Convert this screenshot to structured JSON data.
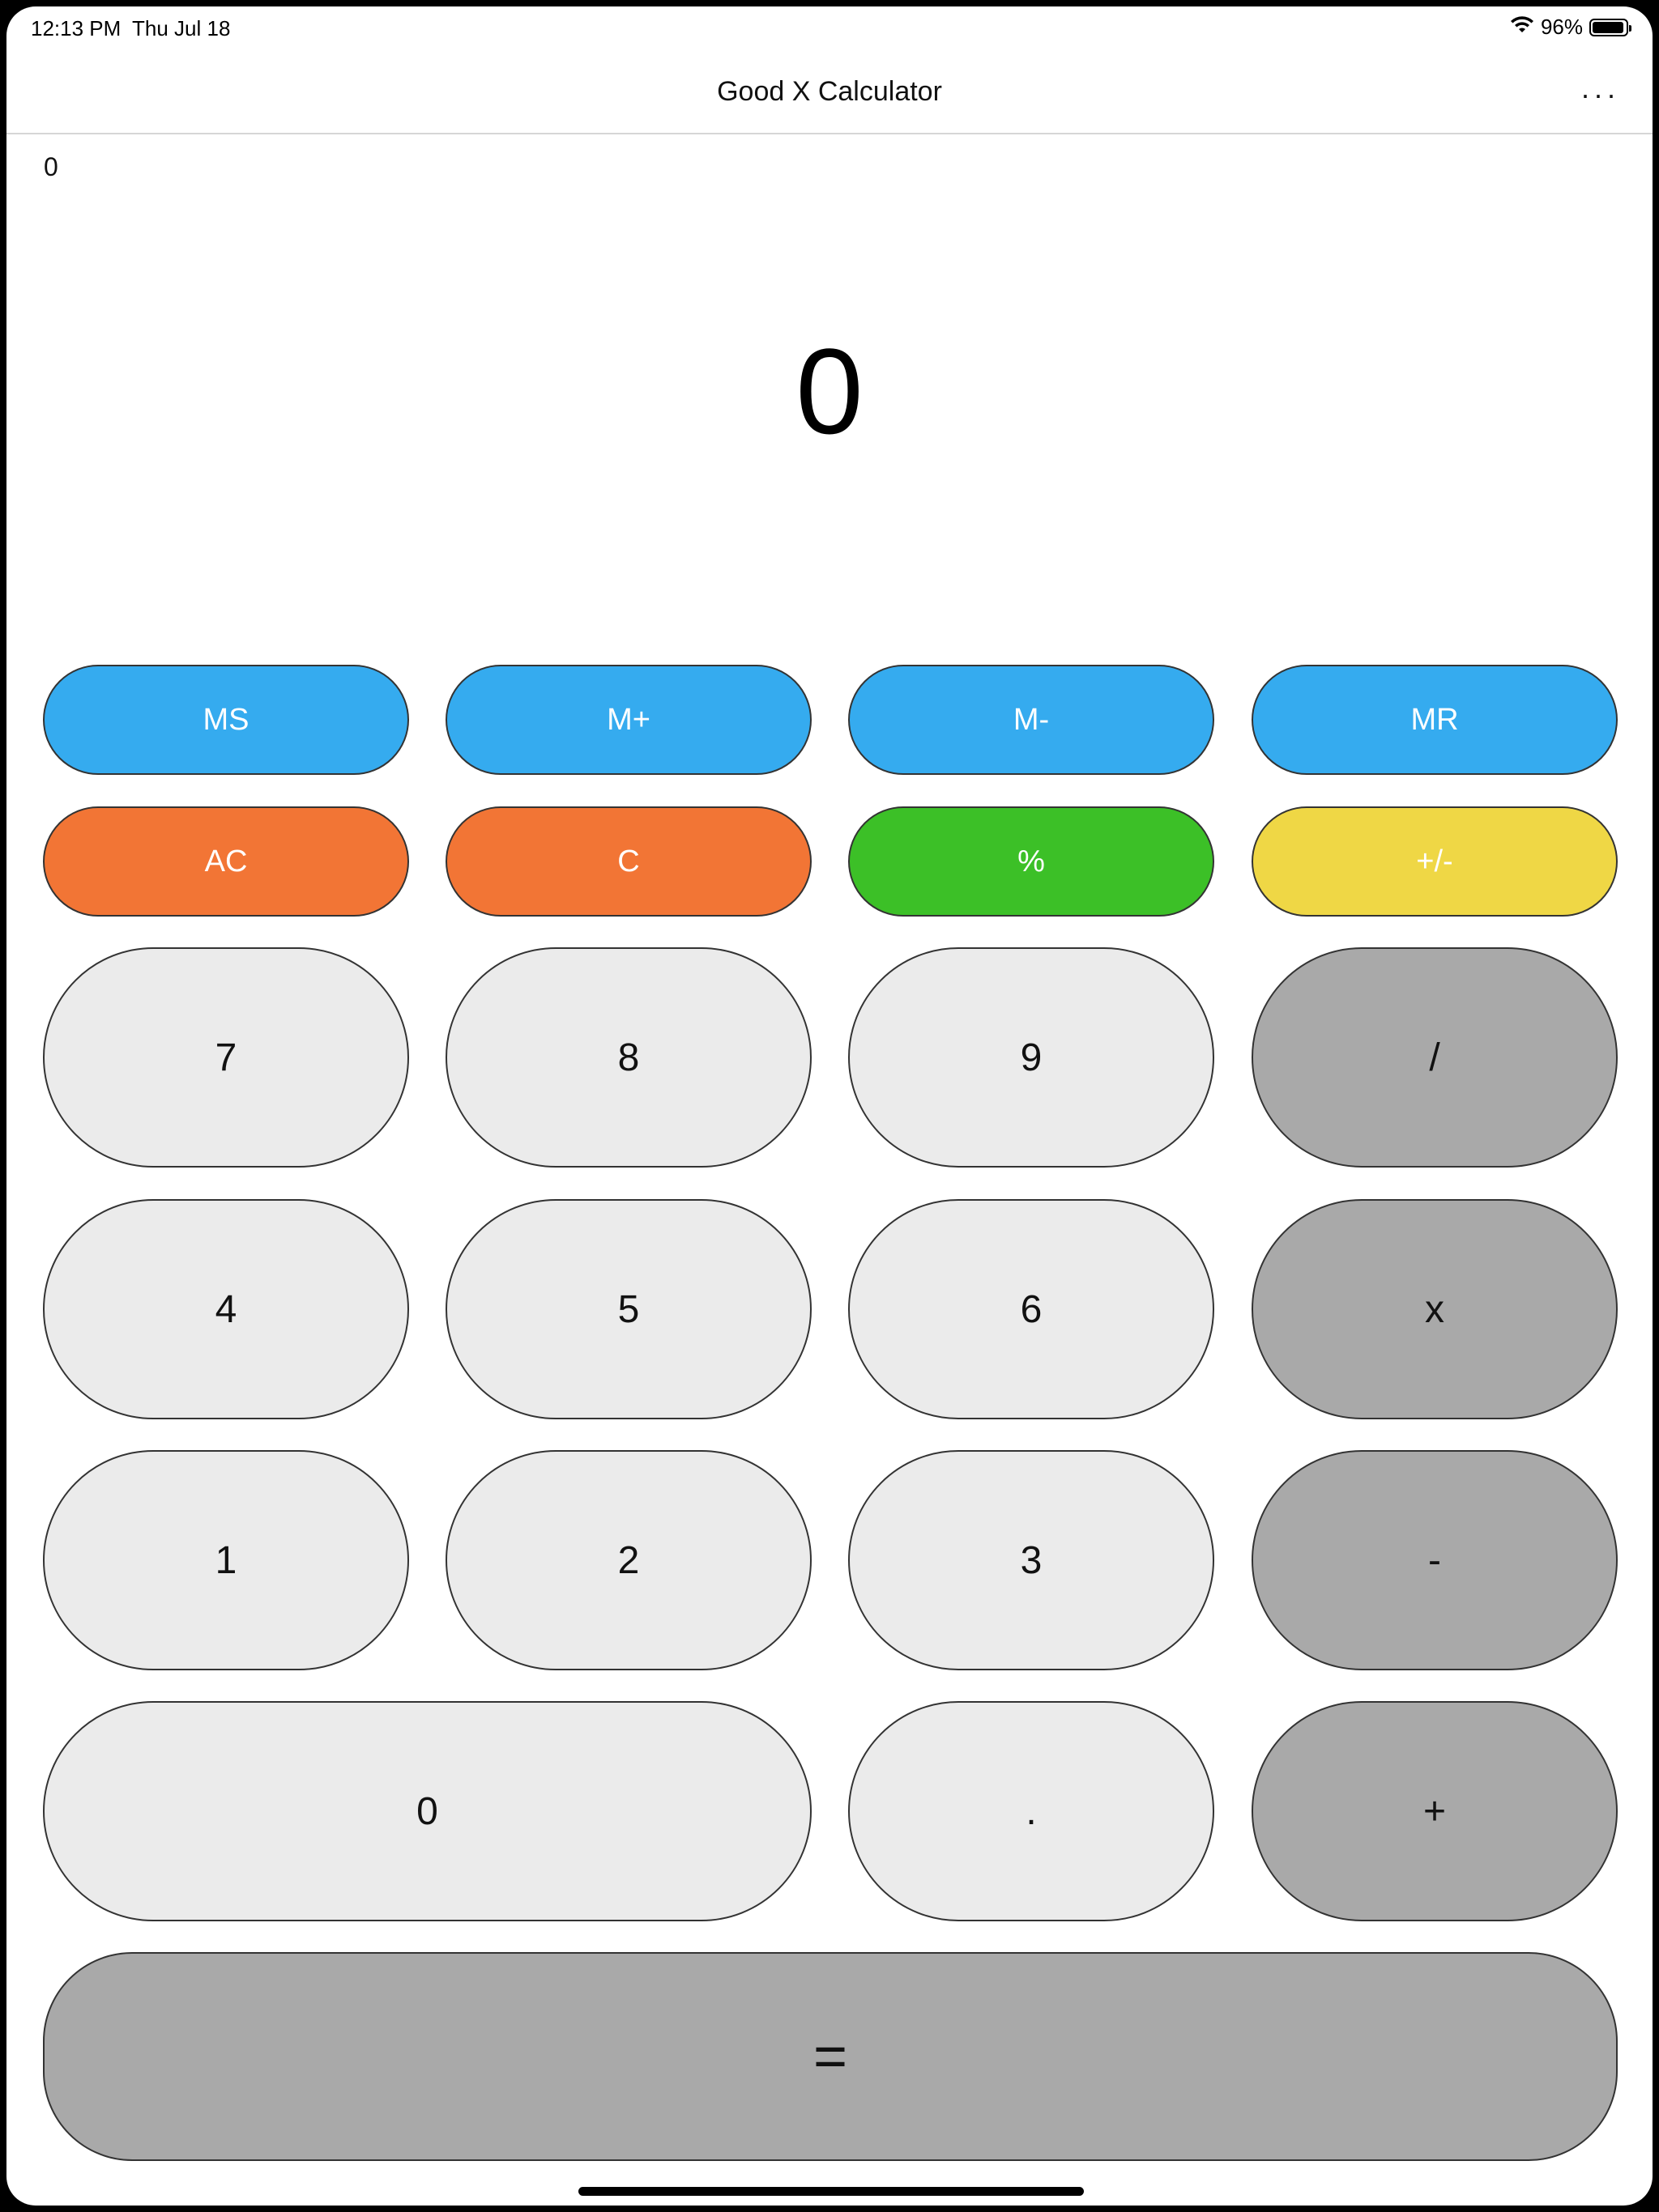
{
  "status": {
    "time": "12:13 PM",
    "date": "Thu Jul 18",
    "battery": "96%",
    "battery_level": 0.96
  },
  "nav": {
    "title": "Good X Calculator",
    "more": "..."
  },
  "display": {
    "history": "0",
    "value": "0"
  },
  "memory": {
    "ms": "MS",
    "mplus": "M+",
    "mminus": "M-",
    "mr": "MR"
  },
  "functions": {
    "ac": "AC",
    "c": "C",
    "percent": "%",
    "sign": "+/-"
  },
  "keys": {
    "k7": "7",
    "k8": "8",
    "k9": "9",
    "divide": "/",
    "k4": "4",
    "k5": "5",
    "k6": "6",
    "multiply": "x",
    "k1": "1",
    "k2": "2",
    "k3": "3",
    "minus": "-",
    "k0": "0",
    "dot": ".",
    "plus": "+",
    "equals": "="
  },
  "colors": {
    "memory": "#35abef",
    "clear": "#f27535",
    "percent": "#3cc027",
    "sign": "#efd745",
    "digit": "#ebebeb",
    "operator": "#a9a9a9"
  }
}
